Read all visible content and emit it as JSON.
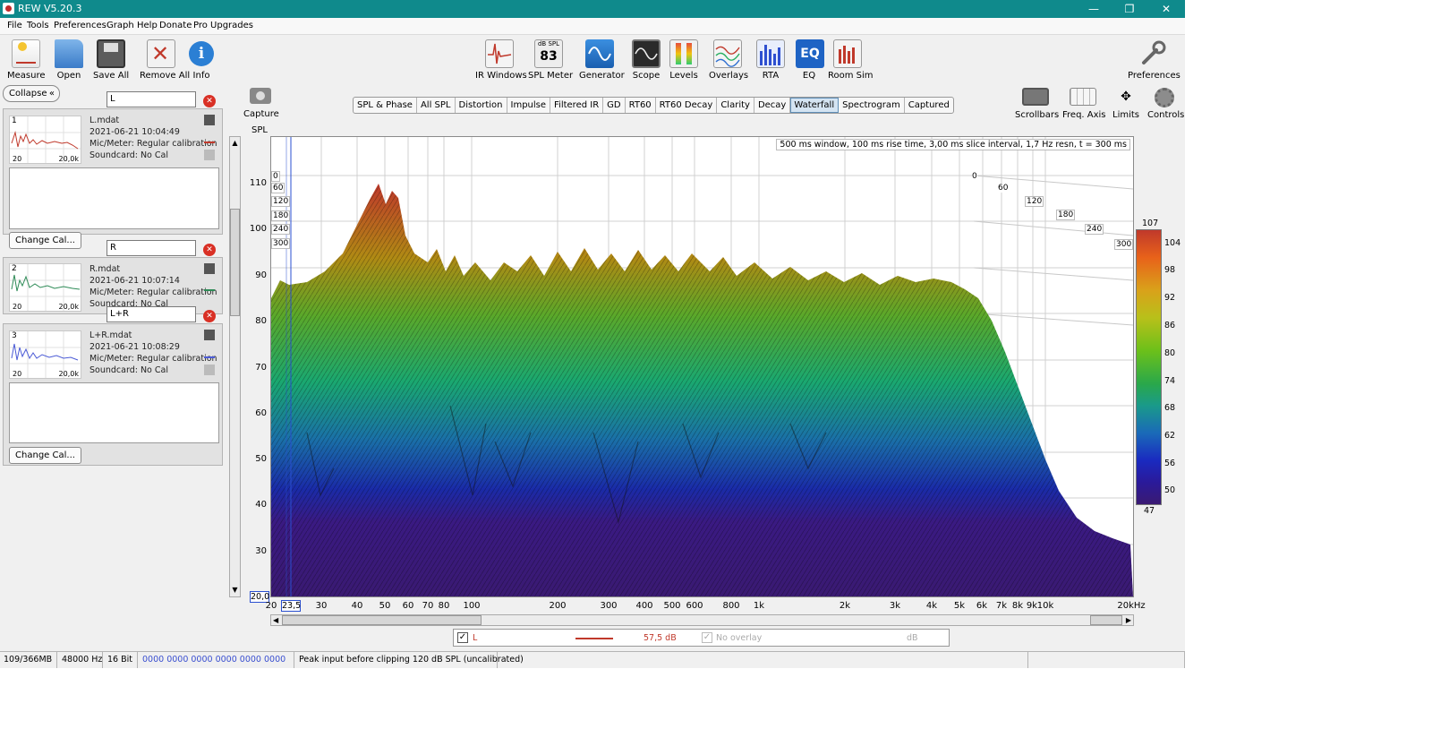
{
  "window": {
    "title": "REW V5.20.3",
    "minimize": "—",
    "maximize": "❐",
    "close": "✕"
  },
  "menu": [
    "File",
    "Tools",
    "Preferences",
    "Graph",
    "Help",
    "Donate",
    "Pro Upgrades"
  ],
  "toolbar_left": [
    "Measure",
    "Open",
    "Save All",
    "Remove All",
    "Info"
  ],
  "toolbar_center": [
    "IR Windows",
    "SPL Meter",
    "Generator",
    "Scope",
    "Levels",
    "Overlays",
    "RTA",
    "EQ",
    "Room Sim"
  ],
  "spl_meter_icon": {
    "unit": "dB SPL",
    "value": "83"
  },
  "eq_icon_text": "EQ",
  "preferences_label": "Preferences",
  "graph_tools": [
    "Scrollbars",
    "Freq. Axis",
    "Limits",
    "Controls"
  ],
  "capture_label": "Capture",
  "collapse_label": "Collapse",
  "measurements": [
    {
      "num": "1",
      "name_field": "L",
      "file": "L.mdat",
      "date": "2021-06-21 10:04:49",
      "mic": "Mic/Meter: Regular calibration",
      "soundcard": "Soundcard: No Cal",
      "thumb_lo": "20",
      "thumb_hi": "20,0k",
      "color": "#c0392b"
    },
    {
      "num": "2",
      "name_field": "R",
      "file": "R.mdat",
      "date": "2021-06-21 10:07:14",
      "mic": "Mic/Meter: Regular calibration",
      "soundcard": "Soundcard: No Cal",
      "thumb_lo": "20",
      "thumb_hi": "20,0k",
      "color": "#2e8b57"
    },
    {
      "num": "3",
      "name_field": "L+R",
      "file": "L+R.mdat",
      "date": "2021-06-21 10:08:29",
      "mic": "Mic/Meter: Regular calibration",
      "soundcard": "Soundcard: No Cal",
      "thumb_lo": "20",
      "thumb_hi": "20,0k",
      "color": "#4b5bd6"
    }
  ],
  "change_cal_label": "Change Cal...",
  "tabs": [
    "SPL & Phase",
    "All SPL",
    "Distortion",
    "Impulse",
    "Filtered IR",
    "GD",
    "RT60",
    "RT60 Decay",
    "Clarity",
    "Decay",
    "Waterfall",
    "Spectrogram",
    "Captured"
  ],
  "active_tab": "Waterfall",
  "graph": {
    "y_axis_label": "SPL",
    "y_ticks": [
      "110",
      "100",
      "90",
      "80",
      "70",
      "60",
      "50",
      "40",
      "30"
    ],
    "y_min_box": "20,0",
    "x_ticks": [
      "20",
      "30",
      "40",
      "50",
      "60",
      "70",
      "80",
      "100",
      "200",
      "300",
      "400",
      "500",
      "600",
      "800",
      "1k",
      "2k",
      "3k",
      "4k",
      "5k",
      "6k",
      "7k",
      "8k",
      "9k",
      "10k",
      "20kHz"
    ],
    "cursor_freq": "23,5",
    "info_text": "500 ms window, 100 ms rise time, 3,00 ms slice interval, 1,7 Hz resn, t = 300 ms",
    "time_labels_right": [
      "0",
      "60",
      "120",
      "180",
      "240",
      "300"
    ],
    "time_labels_left": [
      "0",
      "60",
      "120",
      "180",
      "240",
      "300"
    ],
    "colorbar_ticks": [
      "107",
      "104",
      "98",
      "92",
      "86",
      "80",
      "74",
      "68",
      "62",
      "56",
      "50",
      "47"
    ]
  },
  "legend": {
    "checked": true,
    "label": "L",
    "value": "57,5 dB",
    "overlay_label": "No overlay",
    "overlay_unit": "dB"
  },
  "status": [
    "109/366MB",
    "48000 Hz",
    "16 Bit",
    "0000 0000   0000 0000   0000 0000",
    "Peak input before clipping 120 dB SPL (uncalibrated)"
  ]
}
